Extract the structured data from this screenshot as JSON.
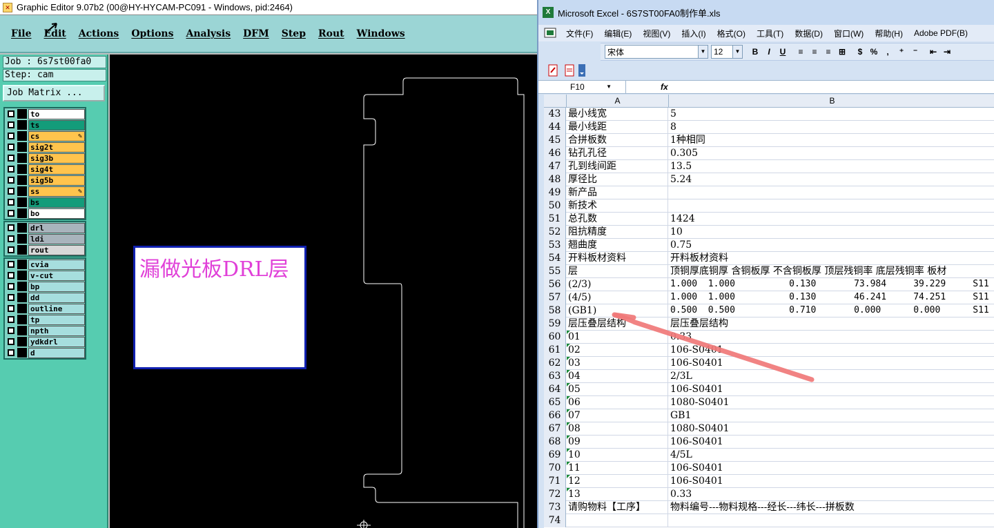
{
  "graphic_editor": {
    "title": "Graphic Editor 9.07b2 (00@HY-HYCAM-PC091 - Windows, pid:2464)",
    "menu": [
      "File",
      "Edit",
      "Actions",
      "Options",
      "Analysis",
      "DFM",
      "Step",
      "Rout",
      "Windows"
    ],
    "job_label": "Job : 6s7st00fa0",
    "step_label": "Step: cam",
    "job_matrix_button": "Job Matrix ...",
    "layer_groups": [
      [
        {
          "name": "to",
          "color": "#ffffff"
        },
        {
          "name": "ts",
          "color": "#139c7a"
        },
        {
          "name": "cs",
          "color": "#ffc44d",
          "marker": true
        },
        {
          "name": "sig2t",
          "color": "#ffc44d"
        },
        {
          "name": "sig3b",
          "color": "#ffc44d"
        },
        {
          "name": "sig4t",
          "color": "#ffc44d"
        },
        {
          "name": "sig5b",
          "color": "#ffc44d"
        },
        {
          "name": "ss",
          "color": "#ffc44d",
          "marker": true
        },
        {
          "name": "bs",
          "color": "#139c7a"
        },
        {
          "name": "bo",
          "color": "#ffffff"
        }
      ],
      [
        {
          "name": "drl",
          "color": "#a8b4bc"
        },
        {
          "name": "ldi",
          "color": "#a8b4bc"
        },
        {
          "name": "rout",
          "color": "#d8d8d8"
        }
      ],
      [
        {
          "name": "cvia",
          "color": "#a6dede"
        },
        {
          "name": "v-cut",
          "color": "#a6dede"
        },
        {
          "name": "bp",
          "color": "#a6dede"
        },
        {
          "name": "dd",
          "color": "#a6dede"
        },
        {
          "name": "outline",
          "color": "#a6dede"
        },
        {
          "name": "tp",
          "color": "#a6dede"
        },
        {
          "name": "npth",
          "color": "#a6dede"
        },
        {
          "name": "ydkdrl",
          "color": "#a6dede"
        },
        {
          "name": "d",
          "color": "#a6dede"
        }
      ]
    ],
    "annotation_text": "漏做光板DRL层"
  },
  "excel": {
    "title": "Microsoft Excel - 6S7ST00FA0制作单.xls",
    "menu": [
      "文件(F)",
      "编辑(E)",
      "视图(V)",
      "插入(I)",
      "格式(O)",
      "工具(T)",
      "数据(D)",
      "窗口(W)",
      "帮助(H)",
      "Adobe PDF(B)"
    ],
    "font_name": "宋体",
    "font_size": "12",
    "name_box": "F10",
    "fx_label": "fx",
    "columns": [
      "A",
      "B"
    ],
    "rows": [
      {
        "n": "43",
        "a": "最小线宽",
        "b": "5"
      },
      {
        "n": "44",
        "a": "最小线距",
        "b": "8"
      },
      {
        "n": "45",
        "a": "合拼板数",
        "b": "1种相同"
      },
      {
        "n": "46",
        "a": "钻孔孔径",
        "b": "0.305"
      },
      {
        "n": "47",
        "a": "孔到线间距",
        "b": "13.5"
      },
      {
        "n": "48",
        "a": "厚径比",
        "b": "5.24"
      },
      {
        "n": "49",
        "a": "新产品",
        "b": ""
      },
      {
        "n": "50",
        "a": "新技术",
        "b": ""
      },
      {
        "n": "51",
        "a": "总孔数",
        "b": "1424"
      },
      {
        "n": "52",
        "a": "阻抗精度",
        "b": "10"
      },
      {
        "n": "53",
        "a": "翘曲度",
        "b": "0.75"
      },
      {
        "n": "54",
        "a": "开料板材资料",
        "b": "开料板材资料"
      },
      {
        "n": "55",
        "a": "层",
        "b": "顶铜厚底铜厚 含铜板厚 不含铜板厚 顶层残铜率 底层残铜率 板材"
      },
      {
        "n": "56",
        "a": "(2/3)",
        "b": "1.000  1.000          0.130       73.984     39.229     S11"
      },
      {
        "n": "57",
        "a": "(4/5)",
        "b": "1.000  1.000          0.130       46.241     74.251     S11"
      },
      {
        "n": "58",
        "a": "(GB1)",
        "b": "0.500  0.500          0.710       0.000      0.000      S11"
      },
      {
        "n": "59",
        "a": "层压叠层结构",
        "b": "层压叠层结构"
      },
      {
        "n": "60",
        "a": "01",
        "b": "0.33"
      },
      {
        "n": "61",
        "a": "02",
        "b": "106-S0401"
      },
      {
        "n": "62",
        "a": "03",
        "b": "106-S0401"
      },
      {
        "n": "63",
        "a": "04",
        "b": "2/3L"
      },
      {
        "n": "64",
        "a": "05",
        "b": "106-S0401"
      },
      {
        "n": "65",
        "a": "06",
        "b": "1080-S0401"
      },
      {
        "n": "66",
        "a": "07",
        "b": "GB1"
      },
      {
        "n": "67",
        "a": "08",
        "b": "1080-S0401"
      },
      {
        "n": "68",
        "a": "09",
        "b": "106-S0401"
      },
      {
        "n": "69",
        "a": "10",
        "b": "4/5L"
      },
      {
        "n": "70",
        "a": "11",
        "b": "106-S0401"
      },
      {
        "n": "71",
        "a": "12",
        "b": "106-S0401"
      },
      {
        "n": "72",
        "a": "13",
        "b": "0.33"
      },
      {
        "n": "73",
        "a": "请购物料【工序】",
        "b": "物料编号---物料规格---经长---纬长---拼板数"
      },
      {
        "n": "74",
        "a": "",
        "b": ""
      }
    ]
  }
}
